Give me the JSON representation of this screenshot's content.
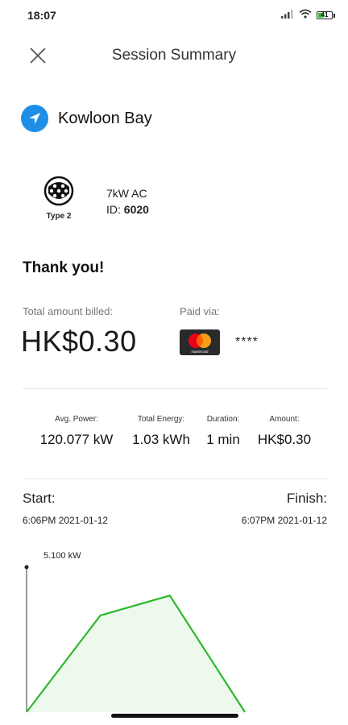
{
  "status_bar": {
    "time": "18:07",
    "battery_level": "41",
    "icons": [
      "signal-icon",
      "wifi-icon",
      "battery-icon"
    ]
  },
  "header": {
    "title": "Session Summary",
    "close_icon": "close-icon"
  },
  "location": {
    "name": "Kowloon Bay",
    "icon": "navigation-arrow-icon",
    "icon_color": "#1e8ee6"
  },
  "charger": {
    "connector_type": "Type 2",
    "connector_icon": "type2-plug-icon",
    "power_type": "7kW AC",
    "id_label": "ID:",
    "id_value": "6020"
  },
  "thank_you": "Thank you!",
  "billing": {
    "total_label": "Total amount billed:",
    "total_amount": "HK$0.30",
    "paid_via_label": "Paid via:",
    "card_brand": "mastercard",
    "card_brand_text": "mastercard",
    "card_masked": "****"
  },
  "stats": [
    {
      "label": "Avg. Power:",
      "value": "120.077 kW"
    },
    {
      "label": "Total Energy:",
      "value": "1.03 kWh"
    },
    {
      "label": "Duration:",
      "value": "1 min"
    },
    {
      "label": "Amount:",
      "value": "HK$0.30"
    }
  ],
  "session": {
    "start_label": "Start:",
    "start_time": "6:06PM  2021-01-12",
    "finish_label": "Finish:",
    "finish_time": "6:07PM  2021-01-12"
  },
  "chart_data": {
    "type": "area",
    "peak_label": "5.100 kW",
    "ymax": 5.1,
    "line_color": "#2db82d",
    "fill_color": "#eef9ee",
    "points": [
      {
        "t": 0.0,
        "kw": 0.0
      },
      {
        "t": 0.338,
        "kw": 3.4
      },
      {
        "t": 0.656,
        "kw": 4.1
      },
      {
        "t": 1.0,
        "kw": 0.0
      }
    ]
  }
}
